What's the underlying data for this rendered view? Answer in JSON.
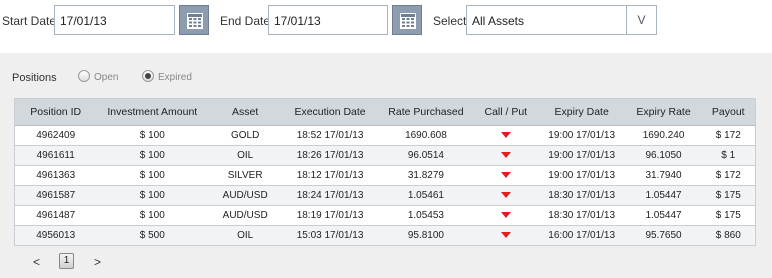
{
  "filters": {
    "start_label": "Start Date",
    "start_value": "17/01/13",
    "end_label": "End Date",
    "end_value": "17/01/13",
    "select_label": "Select",
    "select_value": "All Assets",
    "select_arrow": "V"
  },
  "positions": {
    "label": "Positions",
    "open_label": "Open",
    "expired_label": "Expired",
    "selected": "Expired"
  },
  "table": {
    "headers": [
      "Position ID",
      "Investment Amount",
      "Asset",
      "Execution Date",
      "Rate Purchased",
      "Call / Put",
      "Expiry Date",
      "Expiry Rate",
      "Payout"
    ],
    "rows": [
      {
        "id": "4962409",
        "amount": "$ 100",
        "asset": "GOLD",
        "exec": "18:52 17/01/13",
        "rate": "1690.608",
        "callput": "put",
        "expiry": "19:00 17/01/13",
        "exp_rate": "1690.240",
        "payout": "$ 172"
      },
      {
        "id": "4961611",
        "amount": "$ 100",
        "asset": "OIL",
        "exec": "18:26 17/01/13",
        "rate": "96.0514",
        "callput": "put",
        "expiry": "19:00 17/01/13",
        "exp_rate": "96.1050",
        "payout": "$ 1"
      },
      {
        "id": "4961363",
        "amount": "$ 100",
        "asset": "SILVER",
        "exec": "18:12 17/01/13",
        "rate": "31.8279",
        "callput": "put",
        "expiry": "19:00 17/01/13",
        "exp_rate": "31.7940",
        "payout": "$ 172"
      },
      {
        "id": "4961587",
        "amount": "$ 100",
        "asset": "AUD/USD",
        "exec": "18:24 17/01/13",
        "rate": "1.05461",
        "callput": "put",
        "expiry": "18:30 17/01/13",
        "exp_rate": "1.05447",
        "payout": "$ 175"
      },
      {
        "id": "4961487",
        "amount": "$ 100",
        "asset": "AUD/USD",
        "exec": "18:19 17/01/13",
        "rate": "1.05453",
        "callput": "put",
        "expiry": "18:30 17/01/13",
        "exp_rate": "1.05447",
        "payout": "$ 175"
      },
      {
        "id": "4956013",
        "amount": "$ 500",
        "asset": "OIL",
        "exec": "15:03 17/01/13",
        "rate": "95.8100",
        "callput": "put",
        "expiry": "16:00 17/01/13",
        "exp_rate": "95.7650",
        "payout": "$ 860"
      }
    ]
  },
  "pager": {
    "prev": "<",
    "page": "1",
    "next": ">"
  },
  "colors": {
    "panel_bg": "#efefef",
    "header_bg": "#d3d8dd",
    "put_arrow": "#e02020",
    "calendar_btn": "#8d9cae"
  },
  "icons": {
    "calendar": "calendar-icon",
    "put": "down-triangle-icon"
  }
}
